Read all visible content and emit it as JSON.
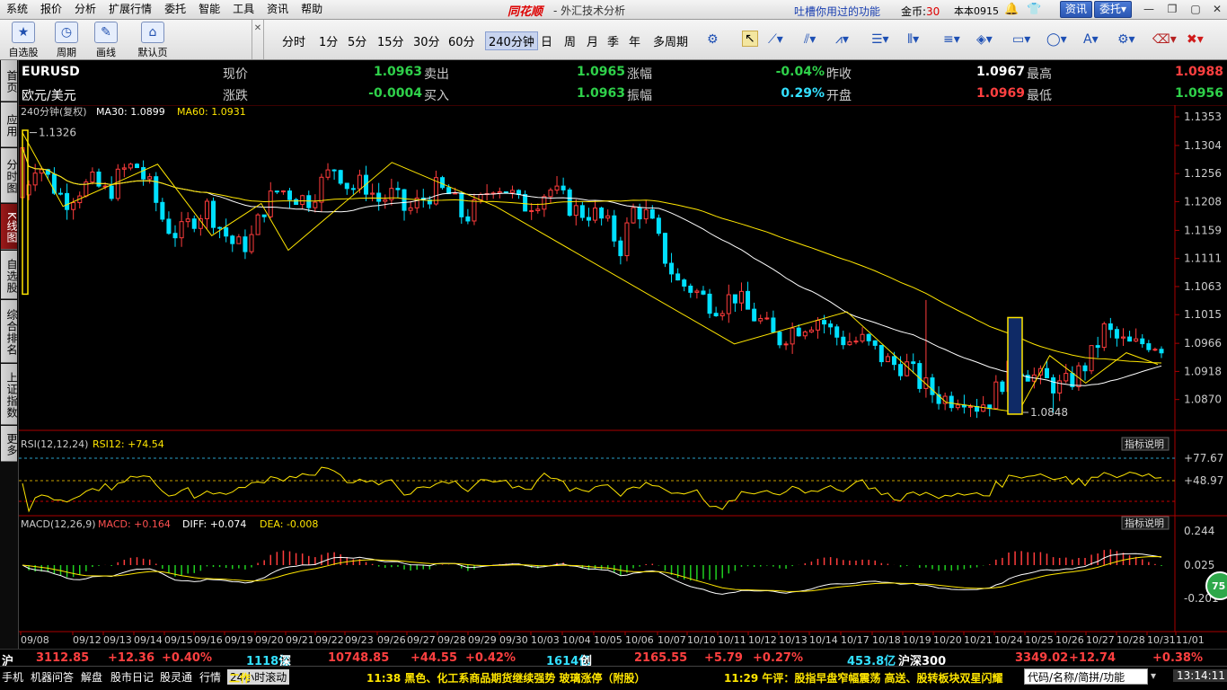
{
  "menubar": {
    "items": [
      "系统",
      "报价",
      "分析",
      "扩展行情",
      "委托",
      "智能",
      "工具",
      "资讯",
      "帮助"
    ],
    "brand": "同花顺",
    "app_title": "- 外汇技术分析",
    "promo": "吐槽你用过的功能",
    "coins_label": "金币:",
    "coins_value": "30",
    "version": "本本0915",
    "news_btn": "资讯",
    "trade_btn": "委托"
  },
  "toolbar": {
    "big_buttons": [
      {
        "label": "自选股",
        "icon": "star-icon"
      },
      {
        "label": "周期",
        "icon": "cycle-icon"
      },
      {
        "label": "画线",
        "icon": "pen-icon"
      },
      {
        "label": "默认页",
        "icon": "home-icon"
      }
    ],
    "periods": [
      "分时",
      "1分",
      "5分",
      "15分",
      "30分",
      "60分",
      "240分钟",
      "日",
      "周",
      "月",
      "季",
      "年",
      "多周期"
    ],
    "selected_period": "240分钟"
  },
  "left_tabs": [
    "首页",
    "应用",
    "分时图",
    "K线图",
    "自选股",
    "综合排名",
    "上证指数",
    "更多"
  ],
  "active_left_tab": "K线图",
  "quote": {
    "symbol": "EURUSD",
    "name": "欧元/美元",
    "rows": [
      [
        {
          "l": "现价",
          "v": "1.0963",
          "c": "qg"
        },
        {
          "l": "卖出",
          "v": "1.0965",
          "c": "qg"
        },
        {
          "l": "涨幅",
          "v": "-0.04%",
          "c": "qg"
        },
        {
          "l": "昨收",
          "v": "1.0967",
          "c": "qw"
        },
        {
          "l": "最高",
          "v": "1.0988",
          "c": "qr"
        }
      ],
      [
        {
          "l": "涨跌",
          "v": "-0.0004",
          "c": "qg"
        },
        {
          "l": "买入",
          "v": "1.0963",
          "c": "qg"
        },
        {
          "l": "振幅",
          "v": "0.29%",
          "c": "qc"
        },
        {
          "l": "开盘",
          "v": "1.0969",
          "c": "qr"
        },
        {
          "l": "最低",
          "v": "1.0956",
          "c": "qg"
        }
      ]
    ]
  },
  "indicators": {
    "main_label": "240分钟(复权)",
    "ma30_label": "MA30: 1.0899",
    "ma60_label": "MA60: 1.0931",
    "rsi_label": "RSI(12,12,24)",
    "rsi12_label": "RSI12: +74.54",
    "macd_label": "MACD(12,26,9)",
    "macd_val": "MACD: +0.164",
    "diff_val": "DIFF: +0.074",
    "dea_val": "DEA: -0.008",
    "explain_btn": "指标说明",
    "rsi_axis": [
      "+77.67",
      "+48.97"
    ],
    "macd_axis": [
      "0.244",
      "0.025",
      "-0.201"
    ],
    "high_mark": "1.1326",
    "low_mark": "1.0848",
    "badge": "75"
  },
  "chart_data": {
    "type": "candlestick",
    "yaxis_ticks": [
      "1.1353",
      "1.1304",
      "1.1256",
      "1.1208",
      "1.1159",
      "1.1111",
      "1.1063",
      "1.1015",
      "1.0966",
      "1.0918",
      "1.0870"
    ],
    "ylim": [
      1.0825,
      1.1353
    ],
    "x_labels": [
      "09/08",
      "09/12",
      "09/13",
      "09/14",
      "09/15",
      "09/16",
      "09/19",
      "09/20",
      "09/21",
      "09/22",
      "09/23",
      "09/26",
      "09/27",
      "09/28",
      "09/29",
      "09/30",
      "10/03",
      "10/04",
      "10/05",
      "10/06",
      "10/07",
      "10/10",
      "10/11",
      "10/12",
      "10/13",
      "10/14",
      "10/17",
      "10/18",
      "10/19",
      "10/20",
      "10/21",
      "10/24",
      "10/25",
      "10/26",
      "10/27",
      "10/28",
      "10/31",
      "11/01"
    ],
    "close_path": [
      1.122,
      1.128,
      1.124,
      1.121,
      1.123,
      1.124,
      1.122,
      1.126,
      1.127,
      1.123,
      1.117,
      1.115,
      1.118,
      1.12,
      1.116,
      1.113,
      1.114,
      1.12,
      1.123,
      1.122,
      1.121,
      1.124,
      1.127,
      1.123,
      1.124,
      1.121,
      1.122,
      1.119,
      1.121,
      1.123,
      1.122,
      1.118,
      1.12,
      1.124,
      1.123,
      1.12,
      1.121,
      1.123,
      1.121,
      1.119,
      1.119,
      1.117,
      1.113,
      1.12,
      1.118,
      1.112,
      1.107,
      1.106,
      1.104,
      1.103,
      1.105,
      1.102,
      1.1,
      1.097,
      1.099,
      1.1,
      1.101,
      1.098,
      1.097,
      1.097,
      1.095,
      1.093,
      1.093,
      1.09,
      1.088,
      1.087,
      1.088,
      1.086,
      1.087,
      1.091,
      1.093,
      1.091,
      1.09,
      1.089,
      1.091,
      1.094,
      1.099,
      1.097,
      1.096,
      1.097,
      1.0963
    ]
  },
  "statusbar": {
    "items": [
      {
        "t": "沪",
        "c": "#fff"
      },
      {
        "t": "3112.85",
        "c": "#ff4040"
      },
      {
        "t": "+12.36",
        "c": "#ff4040"
      },
      {
        "t": "+0.40%",
        "c": "#ff4040"
      },
      {
        "t": "1118亿",
        "c": "#33e0ff"
      },
      {
        "t": "深",
        "c": "#fff"
      },
      {
        "t": "10748.85",
        "c": "#ff4040"
      },
      {
        "t": "+44.55",
        "c": "#ff4040"
      },
      {
        "t": "+0.42%",
        "c": "#ff4040"
      },
      {
        "t": "1614亿",
        "c": "#33e0ff"
      },
      {
        "t": "创",
        "c": "#fff"
      },
      {
        "t": "2165.55",
        "c": "#ff4040"
      },
      {
        "t": "+5.79",
        "c": "#ff4040"
      },
      {
        "t": "+0.27%",
        "c": "#ff4040"
      },
      {
        "t": "453.8亿",
        "c": "#33e0ff"
      },
      {
        "t": "沪深300",
        "c": "#fff"
      },
      {
        "t": "3349.02",
        "c": "#ff4040"
      },
      {
        "t": "+12.74",
        "c": "#ff4040"
      },
      {
        "t": "+0.38%",
        "c": "#ff4040"
      }
    ],
    "tabs": [
      "手机",
      "机器问答",
      "解盘",
      "股市日记",
      "股灵通",
      "行情",
      "24小时滚动"
    ],
    "ticker1": "11:38 黑色、化工系商品期货继续强势 玻璃涨停（附股）",
    "ticker2": "11:29 午评：股指早盘窄幅震荡 高送、股转板块双星闪耀",
    "search_placeholder": "代码/名称/简拼/功能",
    "time": "13:14:11"
  }
}
